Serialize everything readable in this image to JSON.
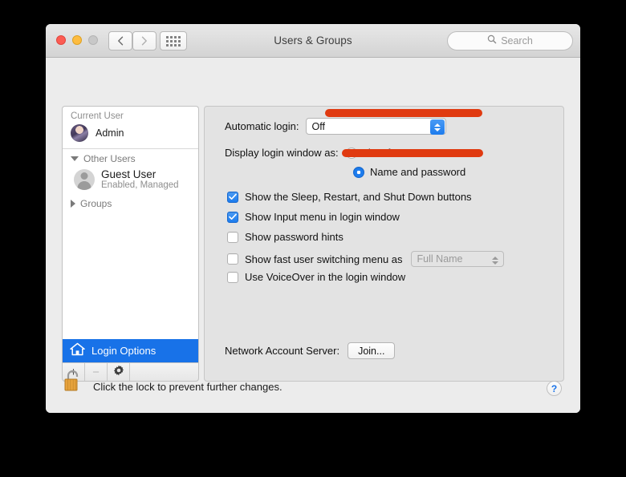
{
  "window": {
    "title": "Users & Groups",
    "traffic_lights": [
      "close",
      "minimize",
      "zoom"
    ],
    "nav": {
      "back": "back-arrow",
      "forward": "forward-arrow",
      "show_all": "grid-icon"
    },
    "search": {
      "placeholder": "Search",
      "value": "",
      "icon": "search-icon"
    }
  },
  "sidebar": {
    "current_user_header": "Current User",
    "current_user": {
      "name": "Admin",
      "avatar": "user-photo"
    },
    "other_users_header": "Other Users",
    "other_users": [
      {
        "name": "Guest User",
        "status": "Enabled, Managed",
        "avatar": "generic-user-icon"
      }
    ],
    "groups_header": "Groups",
    "login_options": {
      "label": "Login Options",
      "icon": "home-icon",
      "selected": true
    },
    "toolbar": {
      "add": "+",
      "remove": "−",
      "settings": "gear-icon"
    }
  },
  "main": {
    "automatic_login": {
      "label": "Automatic login:",
      "value": "Off",
      "options": [
        "Off"
      ]
    },
    "display_login_window": {
      "label": "Display login window as:",
      "options": [
        {
          "label": "List of users",
          "selected": false
        },
        {
          "label": "Name and password",
          "selected": true
        }
      ]
    },
    "checkboxes": [
      {
        "label": "Show the Sleep, Restart, and Shut Down buttons",
        "checked": true
      },
      {
        "label": "Show Input menu in login window",
        "checked": true
      },
      {
        "label": "Show password hints",
        "checked": false
      },
      {
        "label": "Show fast user switching menu as",
        "checked": false
      },
      {
        "label": "Use VoiceOver in the login window",
        "checked": false
      }
    ],
    "fast_user_switching_format": {
      "value": "Full Name",
      "options": [
        "Full Name"
      ],
      "disabled": true
    },
    "network_account_server": {
      "label": "Network Account Server:",
      "button": "Join..."
    }
  },
  "footer": {
    "lock_icon": "unlocked-padlock-icon",
    "text": "Click the lock to prevent further changes.",
    "help": "?"
  },
  "annotations": {
    "color": "#e03a10",
    "strokes": [
      {
        "name": "underline-automatic-login"
      },
      {
        "name": "underline-name-and-password"
      }
    ]
  }
}
